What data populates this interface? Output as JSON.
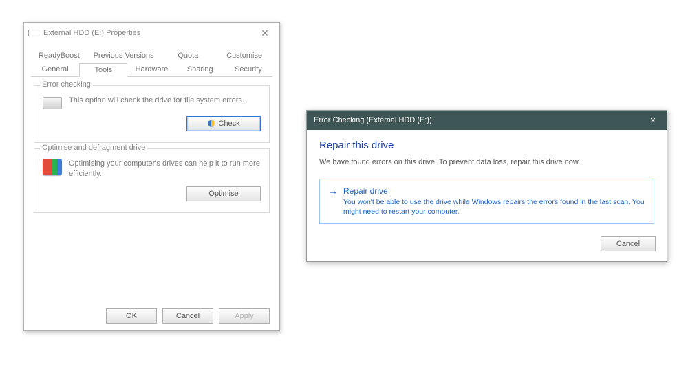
{
  "properties": {
    "title": "External HDD (E:) Properties",
    "tabs_row1": [
      "ReadyBoost",
      "Previous Versions",
      "Quota",
      "Customise"
    ],
    "tabs_row2": [
      "General",
      "Tools",
      "Hardware",
      "Sharing",
      "Security"
    ],
    "active_tab": "Tools",
    "error_checking": {
      "legend": "Error checking",
      "text": "This option will check the drive for file system errors.",
      "button": "Check"
    },
    "optimise": {
      "legend": "Optimise and defragment drive",
      "text": "Optimising your computer's drives can help it to run more efficiently.",
      "button": "Optimise"
    },
    "buttons": {
      "ok": "OK",
      "cancel": "Cancel",
      "apply": "Apply"
    }
  },
  "error_dialog": {
    "title": "Error Checking (External HDD (E:))",
    "heading": "Repair this drive",
    "message": "We have found errors on this drive. To prevent data loss, repair this drive now.",
    "command": {
      "title": "Repair drive",
      "desc": "You won't be able to use the drive while Windows repairs the errors found in the last scan. You might need to restart your computer."
    },
    "cancel": "Cancel"
  }
}
